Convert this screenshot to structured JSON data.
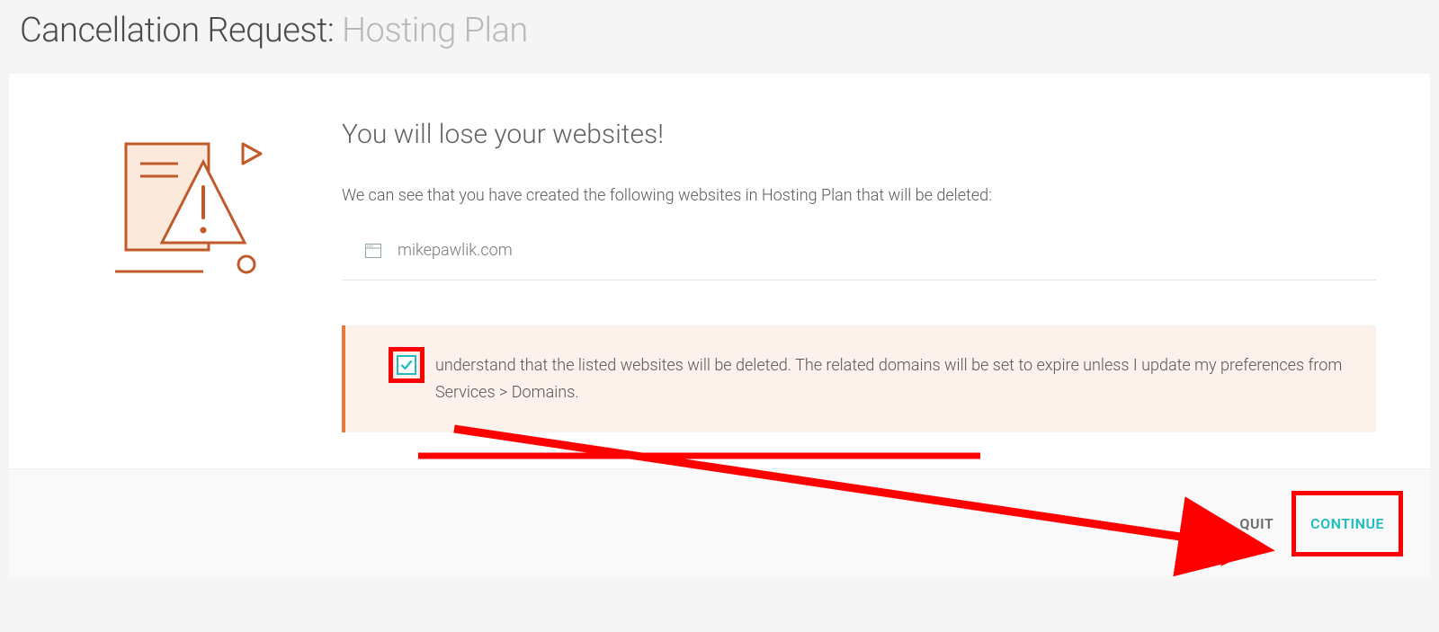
{
  "header": {
    "title_prefix": "Cancellation Request:",
    "title_suffix": "Hosting Plan"
  },
  "main": {
    "heading": "You will lose your websites!",
    "description": "We can see that you have created the following websites in Hosting Plan that will be deleted:",
    "websites": [
      {
        "name": "mikepawlik.com"
      }
    ],
    "confirmation": {
      "checked": true,
      "text": "understand that the listed websites will be deleted. The related domains will be set to expire unless I update my preferences from Services > Domains."
    }
  },
  "footer": {
    "quit_label": "QUIT",
    "continue_label": "CONTINUE"
  },
  "icons": {
    "website": "browser-window-icon",
    "warning_doc": "document-warning-icon",
    "checkmark": "check-icon"
  },
  "colors": {
    "accent": "#1cbdbd",
    "warning_bg": "#fcf2eb",
    "warning_border": "#e8793e",
    "annotation": "#ff0000"
  }
}
